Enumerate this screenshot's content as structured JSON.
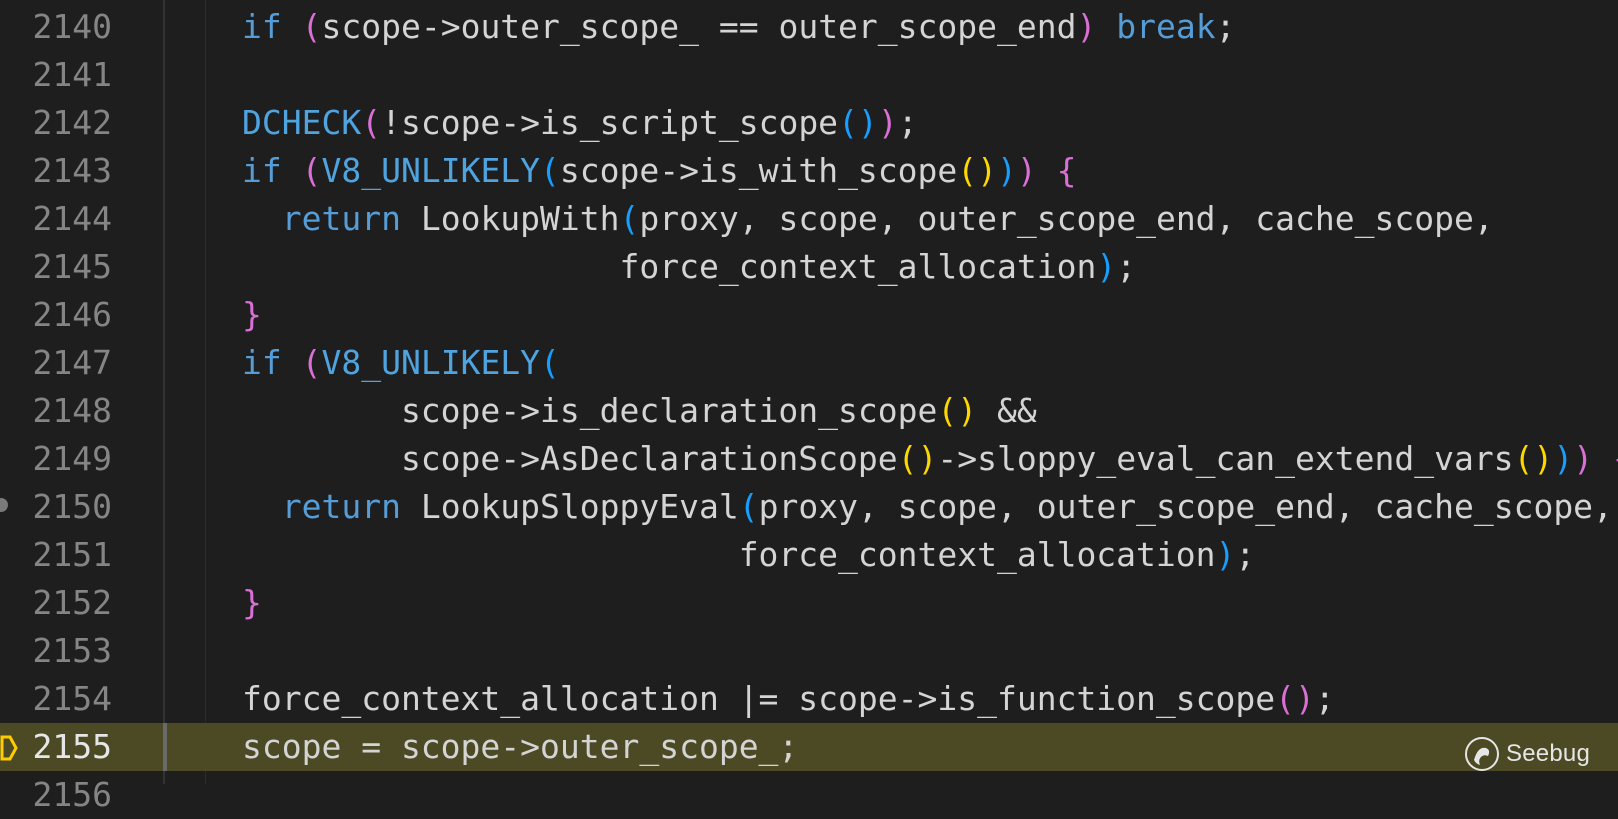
{
  "editor": {
    "lines": [
      {
        "number": "2140",
        "tokens": [
          [
            "kw",
            "if"
          ],
          [
            "op",
            " "
          ],
          [
            "p1",
            "("
          ],
          [
            "op",
            "scope->outer_scope_ == outer_scope_end"
          ],
          [
            "p1",
            ")"
          ],
          [
            "op",
            " "
          ],
          [
            "kw",
            "break"
          ],
          [
            "op",
            ";"
          ]
        ]
      },
      {
        "number": "2141",
        "tokens": []
      },
      {
        "number": "2142",
        "tokens": [
          [
            "mac",
            "DCHECK"
          ],
          [
            "p1",
            "("
          ],
          [
            "op",
            "!scope->is_script_scope"
          ],
          [
            "p2",
            "()"
          ],
          [
            "p1",
            ")"
          ],
          [
            "op",
            ";"
          ]
        ]
      },
      {
        "number": "2143",
        "tokens": [
          [
            "kw",
            "if"
          ],
          [
            "op",
            " "
          ],
          [
            "p1",
            "("
          ],
          [
            "mac",
            "V8_UNLIKELY"
          ],
          [
            "p2",
            "("
          ],
          [
            "op",
            "scope->is_with_scope"
          ],
          [
            "p3",
            "()"
          ],
          [
            "p2",
            ")"
          ],
          [
            "p1",
            ")"
          ],
          [
            "op",
            " "
          ],
          [
            "p1",
            "{"
          ]
        ]
      },
      {
        "number": "2144",
        "tokens": [
          [
            "op",
            "  "
          ],
          [
            "kw",
            "return"
          ],
          [
            "op",
            " LookupWith"
          ],
          [
            "p2",
            "("
          ],
          [
            "op",
            "proxy, scope, outer_scope_end, cache_scope,"
          ]
        ]
      },
      {
        "number": "2145",
        "tokens": [
          [
            "op",
            "                   force_context_allocation"
          ],
          [
            "p2",
            ")"
          ],
          [
            "op",
            ";"
          ]
        ]
      },
      {
        "number": "2146",
        "tokens": [
          [
            "p1",
            "}"
          ]
        ]
      },
      {
        "number": "2147",
        "tokens": [
          [
            "kw",
            "if"
          ],
          [
            "op",
            " "
          ],
          [
            "p1",
            "("
          ],
          [
            "mac",
            "V8_UNLIKELY"
          ],
          [
            "p2",
            "("
          ]
        ]
      },
      {
        "number": "2148",
        "tokens": [
          [
            "op",
            "        scope->is_declaration_scope"
          ],
          [
            "p3",
            "()"
          ],
          [
            "op",
            " &&"
          ]
        ]
      },
      {
        "number": "2149",
        "tokens": [
          [
            "op",
            "        scope->AsDeclarationScope"
          ],
          [
            "p3",
            "()"
          ],
          [
            "op",
            "->sloppy_eval_can_extend_vars"
          ],
          [
            "p3",
            "()"
          ],
          [
            "p2",
            ")"
          ],
          [
            "p1",
            ")"
          ],
          [
            "op",
            " "
          ],
          [
            "p1",
            "{"
          ]
        ]
      },
      {
        "number": "2150",
        "tokens": [
          [
            "op",
            "  "
          ],
          [
            "kw",
            "return"
          ],
          [
            "op",
            " LookupSloppyEval"
          ],
          [
            "p2",
            "("
          ],
          [
            "op",
            "proxy, scope, outer_scope_end, cache_scope,"
          ]
        ]
      },
      {
        "number": "2151",
        "tokens": [
          [
            "op",
            "                         force_context_allocation"
          ],
          [
            "p2",
            ")"
          ],
          [
            "op",
            ";"
          ]
        ]
      },
      {
        "number": "2152",
        "tokens": [
          [
            "p1",
            "}"
          ]
        ]
      },
      {
        "number": "2153",
        "tokens": []
      },
      {
        "number": "2154",
        "tokens": [
          [
            "op",
            "force_context_allocation |= scope->is_function_scope"
          ],
          [
            "p1",
            "()"
          ],
          [
            "op",
            ";"
          ]
        ]
      },
      {
        "number": "2155",
        "tokens": [
          [
            "op",
            "scope = scope->outer_scope_;"
          ]
        ],
        "current": true
      },
      {
        "number": "2156",
        "tokens": []
      }
    ],
    "breakpoint_line": "2150",
    "current_line": "2155"
  },
  "watermark": {
    "text": "Seebug"
  },
  "colors": {
    "background": "#1e1e1e",
    "keyword": "#569cd6",
    "paren_level1": "#da70d6",
    "paren_level2": "#179fff",
    "paren_level3": "#ffd700",
    "current_line_highlight": "#4b4a24"
  }
}
